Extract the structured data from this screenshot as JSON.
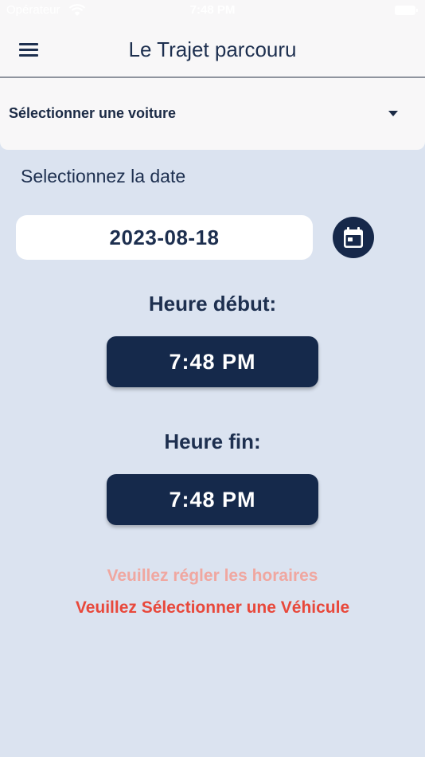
{
  "status_bar": {
    "carrier": "Opérateur",
    "time": "7:48 PM"
  },
  "header": {
    "title": "Le Trajet parcouru",
    "menu_icon": "hamburger-menu-icon"
  },
  "vehicle_select": {
    "label": "Sélectionner une voiture",
    "icon": "dropdown-arrow-icon"
  },
  "date_section": {
    "prompt": "Selectionnez la date",
    "value": "2023-08-18",
    "calendar_icon": "calendar-icon"
  },
  "start_time": {
    "label": "Heure début:",
    "value": "7:48 PM"
  },
  "end_time": {
    "label": "Heure fin:",
    "value": "7:48 PM"
  },
  "messages": {
    "schedule_warning": "Veuillez régler les horaires",
    "vehicle_warning": "Veuillez Sélectionner une Véhicule"
  },
  "colors": {
    "background": "#dbe3f0",
    "primary": "#15294b",
    "warning_light": "#f0a7a0",
    "warning": "#e8483b"
  }
}
